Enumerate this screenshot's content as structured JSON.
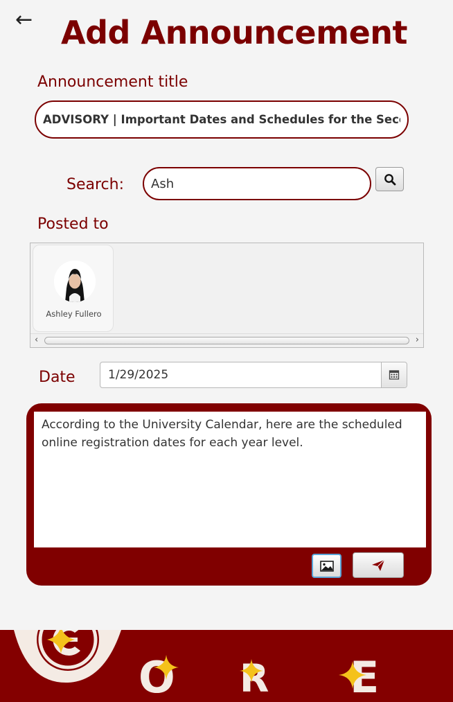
{
  "header": {
    "back_glyph": "←",
    "title": "Add Announcement"
  },
  "form": {
    "title_label": "Announcement title",
    "title_value": "ADVISORY | Important Dates and Schedules for the Second Semester",
    "search_label": "Search:",
    "search_value": "Ash",
    "search_icon": "search-icon",
    "posted_label": "Posted to",
    "recipients": [
      {
        "name": "Ashley Fullero"
      }
    ],
    "date_label": "Date",
    "date_value": "1/29/2025",
    "calendar_icon": "calendar-icon"
  },
  "composer": {
    "body": "According to the University Calendar, here are the scheduled online registration dates for each year level.",
    "image_icon": "image-icon",
    "send_icon": "send-icon"
  },
  "footer": {
    "logo_letters": [
      "C",
      "O",
      "R",
      "E"
    ]
  },
  "colors": {
    "brand": "#7b0000",
    "footer_bg": "#840000",
    "sparkle": "#f4c21b",
    "focus_border": "#5aa5d8"
  }
}
